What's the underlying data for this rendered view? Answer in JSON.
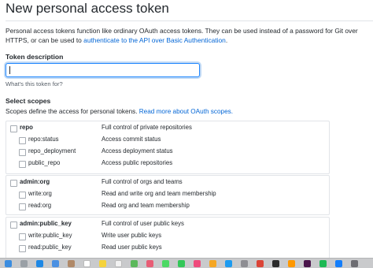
{
  "page": {
    "title": "New personal access token",
    "description_prefix": "Personal access tokens function like ordinary OAuth access tokens. They can be used instead of a password for Git over HTTPS, or can be used to ",
    "description_link": "authenticate to the API over Basic Authentication",
    "description_suffix": "."
  },
  "token": {
    "label": "Token description",
    "value": "",
    "hint": "What's this token for?"
  },
  "scopes": {
    "heading": "Select scopes",
    "intro": "Scopes define the access for personal tokens. ",
    "intro_link": "Read more about OAuth scopes.",
    "groups": [
      {
        "name": "repo",
        "description": "Full control of private repositories",
        "children": [
          {
            "name": "repo:status",
            "description": "Access commit status"
          },
          {
            "name": "repo_deployment",
            "description": "Access deployment status"
          },
          {
            "name": "public_repo",
            "description": "Access public repositories"
          }
        ]
      },
      {
        "name": "admin:org",
        "description": "Full control of orgs and teams",
        "children": [
          {
            "name": "write:org",
            "description": "Read and write org and team membership"
          },
          {
            "name": "read:org",
            "description": "Read org and team membership"
          }
        ]
      },
      {
        "name": "admin:public_key",
        "description": "Full control of user public keys",
        "children": [
          {
            "name": "write:public_key",
            "description": "Write user public keys"
          },
          {
            "name": "read:public_key",
            "description": "Read user public keys"
          }
        ]
      }
    ]
  },
  "dock": {
    "icons": [
      "finder-icon",
      "launchpad-icon",
      "safari-icon",
      "mail-icon",
      "contacts-icon",
      "calendar-icon",
      "notes-icon",
      "reminders-icon",
      "maps-icon",
      "photos-icon",
      "messages-icon",
      "facetime-icon",
      "itunes-icon",
      "ibooks-icon",
      "appstore-icon",
      "preferences-icon",
      "chrome-icon",
      "terminal-icon",
      "sublime-icon",
      "slack-icon",
      "spotify-icon",
      "xcode-icon",
      "trash-icon"
    ],
    "colors": [
      "#3b8de0",
      "#9aa0a6",
      "#1e88e5",
      "#4a90e2",
      "#b08968",
      "#ffffff",
      "#f5d33b",
      "#f2f2f2",
      "#5cb85c",
      "#e85d75",
      "#4cd964",
      "#34c759",
      "#ef4b7c",
      "#f5a623",
      "#1d9bf0",
      "#8e8e93",
      "#db4437",
      "#2b2b2b",
      "#ff9800",
      "#4a154b",
      "#1db954",
      "#147efb",
      "#6d6d72"
    ]
  }
}
